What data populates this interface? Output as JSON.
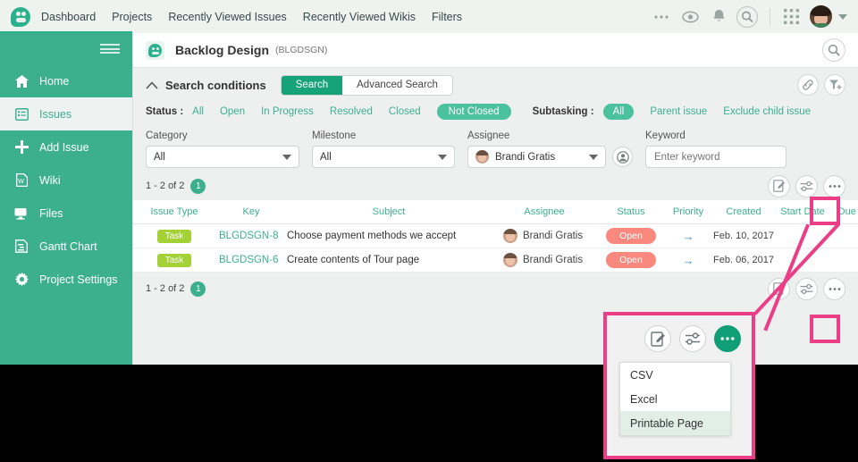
{
  "topnav": {
    "links": [
      "Dashboard",
      "Projects",
      "Recently Viewed Issues",
      "Recently Viewed Wikis",
      "Filters"
    ],
    "icons": [
      "more-icon",
      "eye-icon",
      "bell-icon",
      "search-icon",
      "apps-grid-icon"
    ]
  },
  "sidebar": {
    "items": [
      {
        "label": "Home",
        "icon": "home-icon",
        "active": false
      },
      {
        "label": "Issues",
        "icon": "list-icon",
        "active": true
      },
      {
        "label": "Add Issue",
        "icon": "plus-icon",
        "active": false
      },
      {
        "label": "Wiki",
        "icon": "wiki-icon",
        "active": false
      },
      {
        "label": "Files",
        "icon": "files-icon",
        "active": false
      },
      {
        "label": "Gantt Chart",
        "icon": "gantt-icon",
        "active": false
      },
      {
        "label": "Project Settings",
        "icon": "gear-icon",
        "active": false
      }
    ]
  },
  "project": {
    "title": "Backlog Design",
    "key": "(BLGDSGN)"
  },
  "conditions": {
    "title": "Search conditions",
    "tabs": [
      {
        "label": "Search",
        "active": true
      },
      {
        "label": "Advanced Search",
        "active": false
      }
    ]
  },
  "status_filter": {
    "label": "Status :",
    "options": [
      "All",
      "Open",
      "In Progress",
      "Resolved",
      "Closed",
      "Not Closed"
    ],
    "selected": "Not Closed"
  },
  "subtasking_filter": {
    "label": "Subtasking :",
    "options": [
      "All",
      "Parent issue",
      "Exclude child issue"
    ],
    "selected": "All"
  },
  "fields": {
    "category": {
      "label": "Category",
      "value": "All"
    },
    "milestone": {
      "label": "Milestone",
      "value": "All"
    },
    "assignee": {
      "label": "Assignee",
      "value": "Brandi Gratis"
    },
    "keyword": {
      "label": "Keyword",
      "placeholder": "Enter keyword",
      "value": ""
    }
  },
  "results": {
    "count_text": "1 - 2 of 2",
    "page_badge": "1"
  },
  "table": {
    "headers": [
      "Issue Type",
      "Key",
      "Subject",
      "Assignee",
      "Status",
      "Priority",
      "Created",
      "Start Date",
      "Due date"
    ],
    "rows": [
      {
        "type": "Task",
        "key": "BLGDSGN-8",
        "subject": "Choose payment methods we accept",
        "assignee": "Brandi Gratis",
        "status": "Open",
        "priority": "normal-arrow-icon",
        "created": "Feb. 10, 2017",
        "start_date": "",
        "due_date": ""
      },
      {
        "type": "Task",
        "key": "BLGDSGN-6",
        "subject": "Create contents of Tour page",
        "assignee": "Brandi Gratis",
        "status": "Open",
        "priority": "normal-arrow-icon",
        "created": "Feb. 06, 2017",
        "start_date": "",
        "due_date": ""
      }
    ]
  },
  "export_menu": {
    "items": [
      {
        "label": "CSV",
        "selected": false
      },
      {
        "label": "Excel",
        "selected": false
      },
      {
        "label": "Printable Page",
        "selected": true
      }
    ]
  },
  "colors": {
    "brand_green": "#3cb08d",
    "accent_green": "#17a37a",
    "highlight_pink": "#ec3e86",
    "status_open": "#f9897e",
    "tag_task": "#a3d136"
  }
}
